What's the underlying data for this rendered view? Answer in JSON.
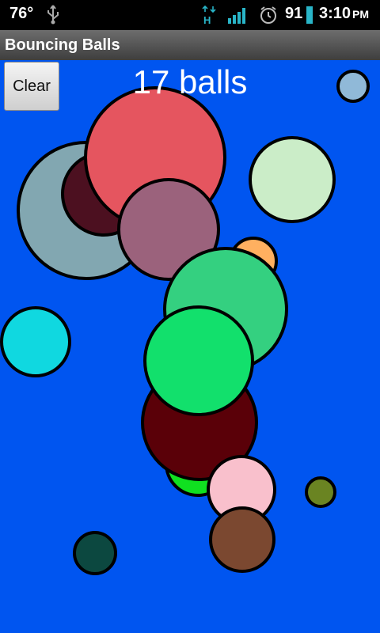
{
  "status_bar": {
    "temperature": "76°",
    "battery_percent": "91",
    "time": "3:10",
    "ampm": "PM",
    "icons": [
      "usb-icon",
      "hspa-icon",
      "signal-icon",
      "alarm-icon",
      "battery-icon"
    ]
  },
  "app": {
    "title": "Bouncing Balls"
  },
  "controls": {
    "clear_label": "Clear",
    "ball_count": "17 balls"
  },
  "balls": [
    {
      "color": "#82a7b1"
    },
    {
      "color": "#4c1020"
    },
    {
      "color": "#e5555f"
    },
    {
      "color": "#9b627c"
    },
    {
      "color": "#90b9d8"
    },
    {
      "color": "#cbedc8"
    },
    {
      "color": "#ffb060"
    },
    {
      "color": "#34d080"
    },
    {
      "color": "#10d8e0"
    },
    {
      "color": "#10e020"
    },
    {
      "color": "#5a0008"
    },
    {
      "color": "#12e06c"
    },
    {
      "color": "#f9c0cc"
    },
    {
      "color": "#6a8422"
    },
    {
      "color": "#7b4830"
    },
    {
      "color": "#0c4840"
    }
  ]
}
